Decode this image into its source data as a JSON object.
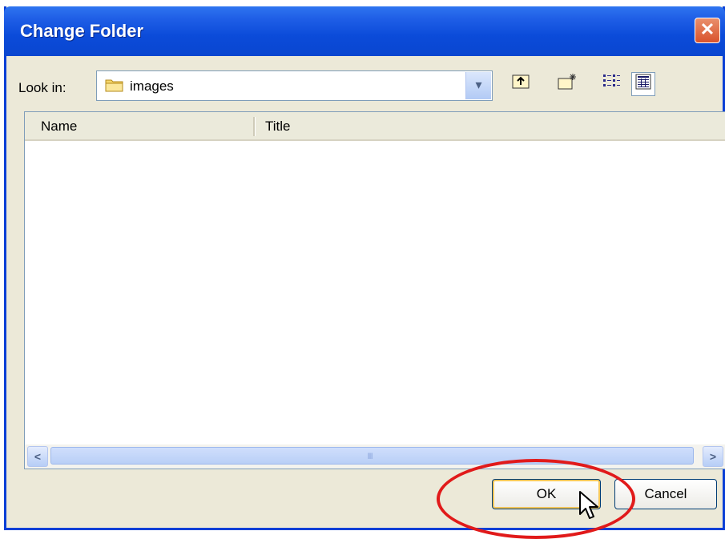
{
  "window": {
    "title": "Change Folder"
  },
  "lookin": {
    "label": "Look in:",
    "value": "images"
  },
  "columns": [
    "Name",
    "Title"
  ],
  "buttons": {
    "ok": "OK",
    "cancel": "Cancel"
  },
  "scrollbar_grip": "III",
  "icons": {
    "close": "close-icon",
    "folder": "folder-icon",
    "up": "up-one-level-icon",
    "newfolder": "new-folder-icon",
    "list": "list-view-icon",
    "details": "details-view-icon"
  },
  "colors": {
    "titlebar": "#0a46d0",
    "highlight": "#e11a1a",
    "dialog": "#ece9d8"
  }
}
